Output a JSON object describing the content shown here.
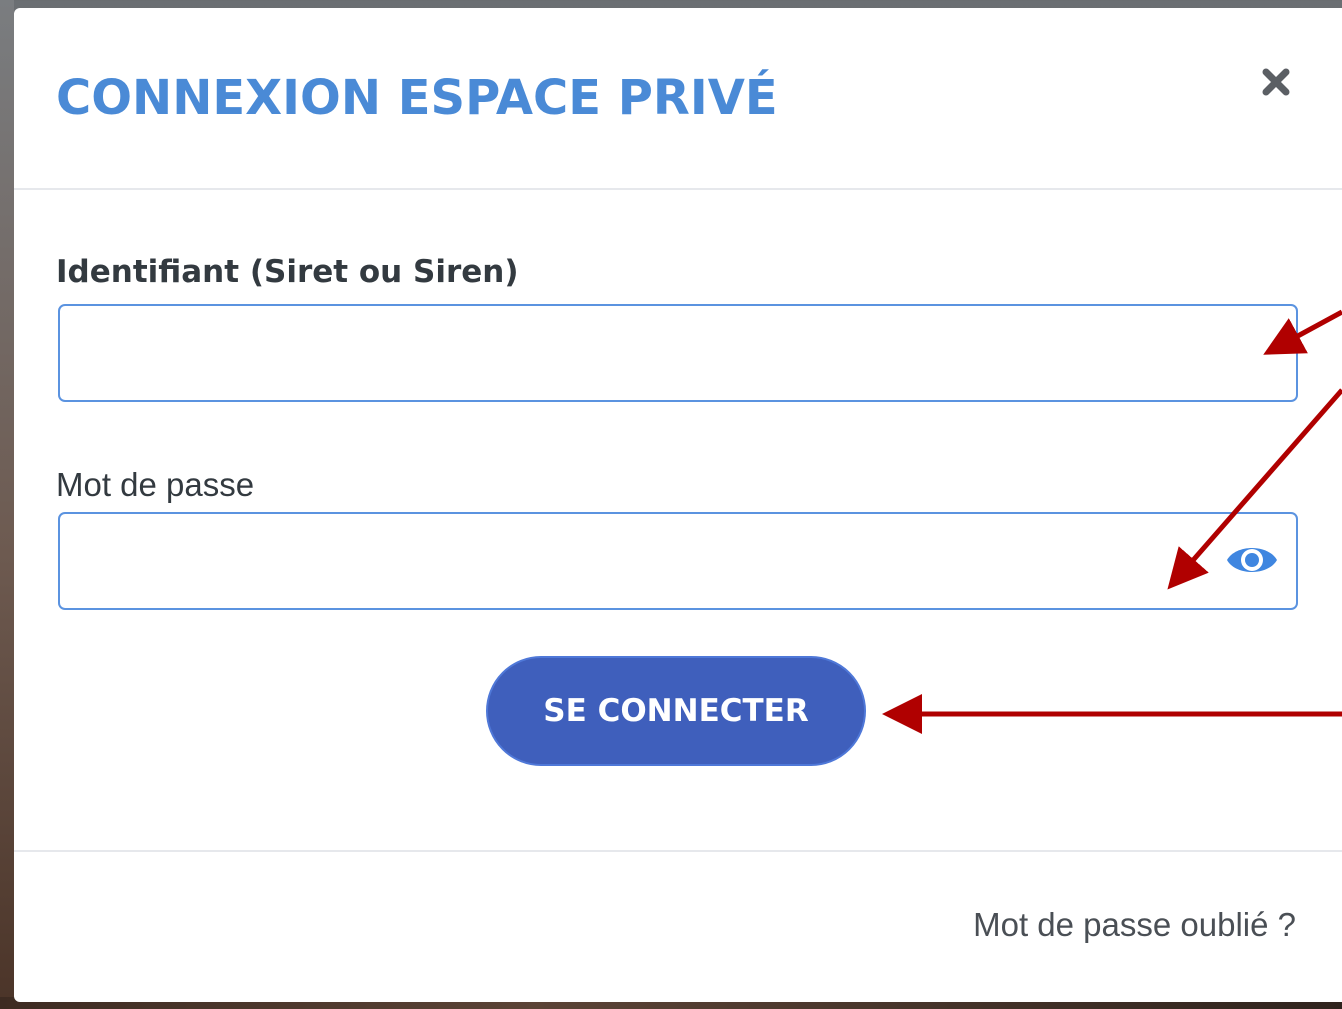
{
  "modal": {
    "title": "CONNEXION ESPACE PRIVÉ",
    "close_icon": "close-icon",
    "title_color": "#4a8ad6"
  },
  "form": {
    "identifier_label": "Identifiant (Siret ou Siren)",
    "identifier_value": "",
    "identifier_placeholder": "",
    "password_label": "Mot de passe",
    "password_value": "",
    "password_placeholder": "",
    "toggle_visibility_icon": "eye-icon",
    "submit_label": "SE CONNECTER",
    "submit_color": "#3f5fbc"
  },
  "footer": {
    "forgot_password_link": "Mot de passe oublié ?"
  },
  "annotations": {
    "arrow_color": "#b00000"
  }
}
